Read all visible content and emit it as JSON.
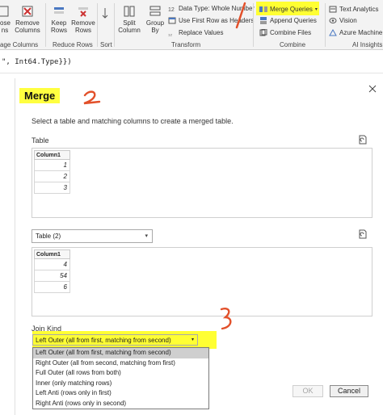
{
  "ribbon": {
    "groups": {
      "manage_columns": "age Columns",
      "reduce_rows": "Reduce Rows",
      "sort": "Sort",
      "transform": "Transform",
      "combine": "Combine",
      "ai_insights": "AI Insights"
    },
    "buttons": {
      "choose_partial": "ose\nns",
      "remove_columns": "Remove\nColumns",
      "keep_rows": "Keep\nRows",
      "remove_rows": "Remove\nRows",
      "split_column": "Split\nColumn",
      "group_by": "Group\nBy",
      "data_type": "Data Type: Whole Number",
      "use_first_row": "Use First Row as Headers",
      "replace_values": "Replace Values",
      "merge_queries": "Merge Queries",
      "append_queries": "Append Queries",
      "combine_files": "Combine Files",
      "text_analytics": "Text Analytics",
      "vision": "Vision",
      "azure_ml": "Azure Machine Le"
    }
  },
  "formula_bar": {
    "text": "\", Int64.Type}})"
  },
  "dialog": {
    "title": "Merge",
    "subtitle": "Select a table and matching columns to create a merged table.",
    "table1": {
      "label": "Table",
      "column": "Column1",
      "rows": [
        "1",
        "2",
        "3"
      ]
    },
    "table2": {
      "selected": "Table (2)",
      "column": "Column1",
      "rows": [
        "4",
        "54",
        "6"
      ]
    },
    "join_kind": {
      "label": "Join Kind",
      "selected": "Left Outer (all from first, matching from second)",
      "options": [
        "Left Outer (all from first, matching from second)",
        "Right Outer (all from second, matching from first)",
        "Full Outer (all rows from both)",
        "Inner (only matching rows)",
        "Left Anti (rows only in first)",
        "Right Anti (rows only in second)"
      ]
    },
    "ok_label": "OK",
    "cancel_label": "Cancel"
  },
  "annotations": [
    "1",
    "2",
    "3"
  ],
  "colors": {
    "highlight": "#ffff33",
    "annotation": "#e2502a",
    "selected_option": "#cfcfcf"
  }
}
